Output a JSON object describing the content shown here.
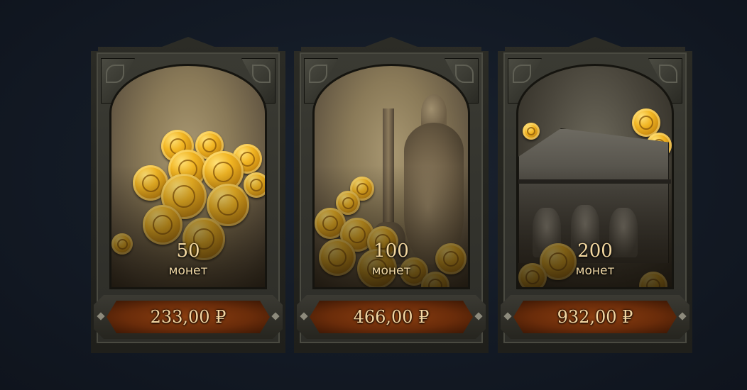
{
  "store": {
    "currency_symbol": "₽",
    "items": [
      {
        "amount": "50",
        "unit": "монет",
        "price": "233,00 ₽",
        "art": "coin-pile-icon"
      },
      {
        "amount": "100",
        "unit": "монет",
        "price": "466,00 ₽",
        "art": "coins-and-vase-icon"
      },
      {
        "amount": "200",
        "unit": "монет",
        "price": "932,00 ₽",
        "art": "treasure-chest-icon"
      }
    ]
  },
  "colors": {
    "background": "#131a25",
    "price_plaque": "#6a2c0a",
    "text_gold": "#f2d7a0",
    "coin": "#f2b624"
  }
}
